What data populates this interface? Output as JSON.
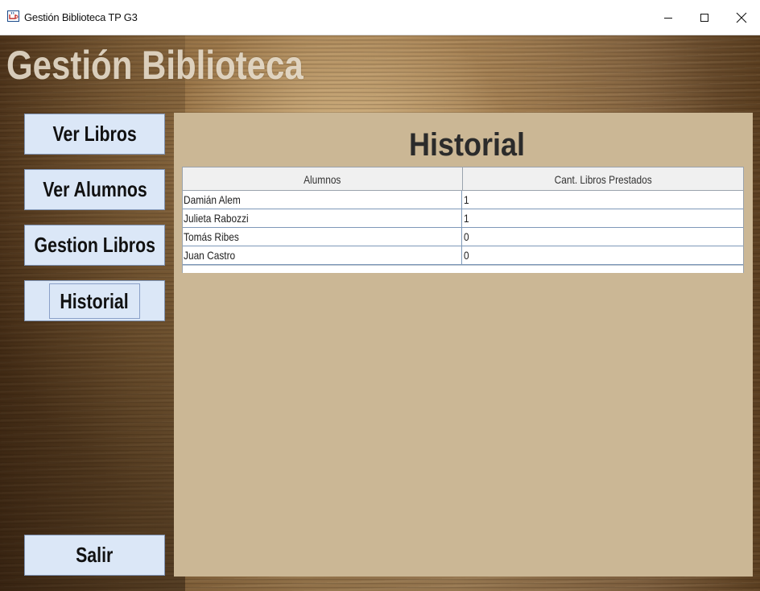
{
  "window": {
    "title": "Gestión Biblioteca TP G3",
    "minimize_glyph": "–",
    "maximize_glyph": "☐",
    "close_glyph": "✕"
  },
  "app": {
    "heading": "Gestión Biblioteca"
  },
  "sidebar": {
    "buttons": [
      {
        "label": "Ver Libros"
      },
      {
        "label": "Ver Alumnos"
      },
      {
        "label": "Gestion Libros"
      },
      {
        "label": "Historial"
      }
    ],
    "exit_label": "Salir"
  },
  "main": {
    "title": "Historial",
    "table": {
      "columns": [
        "Alumnos",
        "Cant. Libros Prestados"
      ],
      "rows": [
        [
          "Damián Alem",
          "1"
        ],
        [
          "Julieta Rabozzi",
          "1"
        ],
        [
          "Tomás Ribes",
          "0"
        ],
        [
          "Juan Castro",
          "0"
        ]
      ]
    }
  },
  "colors": {
    "button_bg": "#dbe7f7",
    "panel_bg": "#cbb795",
    "row_border": "#7e99b9"
  },
  "icons": {
    "app": "java-cup-icon",
    "minimize": "minimize-icon",
    "maximize": "maximize-icon",
    "close": "close-icon"
  }
}
